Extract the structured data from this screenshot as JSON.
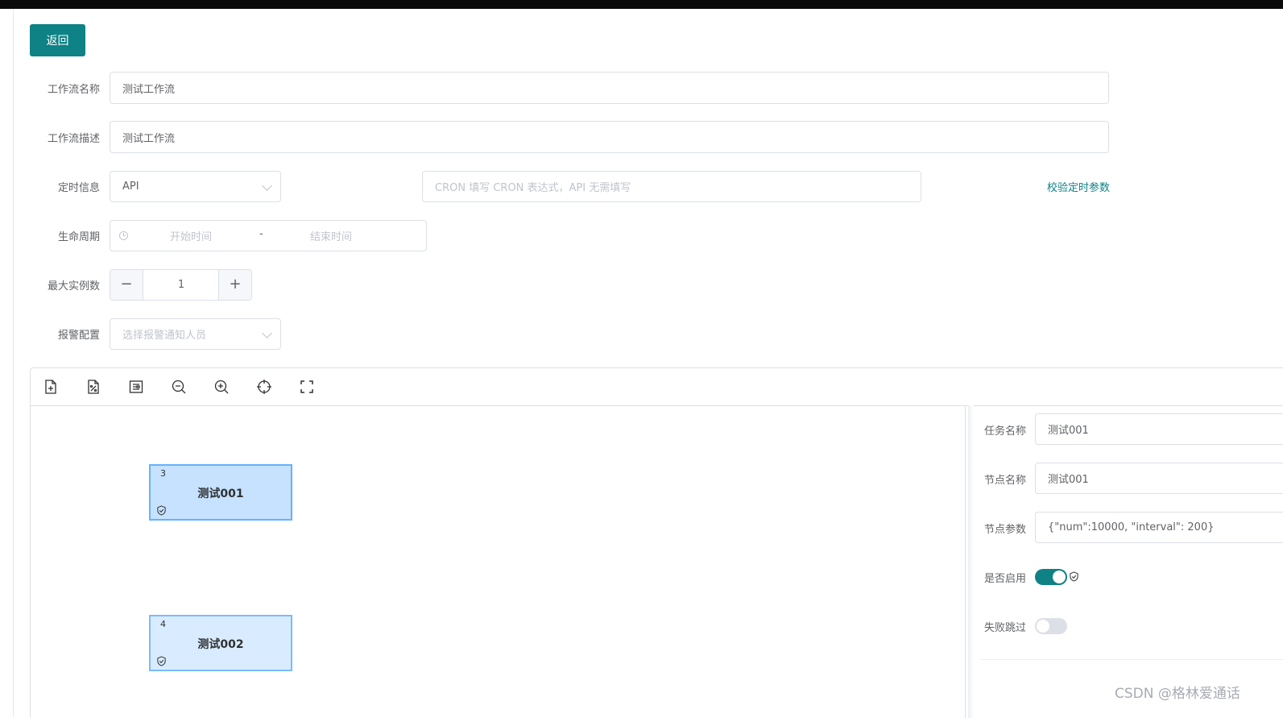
{
  "header": {
    "back_label": "返回"
  },
  "form": {
    "name_label": "工作流名称",
    "name_value": "测试工作流",
    "desc_label": "工作流描述",
    "desc_value": "测试工作流",
    "schedule_label": "定时信息",
    "schedule_type": "API",
    "cron_placeholder": "CRON 填写 CRON 表达式，API 无需填写",
    "validate_link": "校验定时参数",
    "lifecycle_label": "生命周期",
    "start_placeholder": "开始时间",
    "range_separator": "-",
    "end_placeholder": "结束时间",
    "max_instances_label": "最大实例数",
    "max_instances_value": "1",
    "minus_symbol": "−",
    "plus_symbol": "+",
    "alarm_label": "报警配置",
    "alarm_placeholder": "选择报警通知人员"
  },
  "toolbar": {
    "tools": [
      "add-file-icon",
      "percent-file-icon",
      "layout-icon",
      "zoom-out-icon",
      "zoom-in-icon",
      "locate-icon",
      "fullscreen-icon"
    ]
  },
  "canvas": {
    "nodes": [
      {
        "id": "3",
        "title": "测试001",
        "selected": true
      },
      {
        "id": "4",
        "title": "测试002",
        "selected": false
      }
    ]
  },
  "panel": {
    "task_name_label": "任务名称",
    "task_name_value": "测试001",
    "node_name_label": "节点名称",
    "node_name_value": "测试001",
    "node_params_label": "节点参数",
    "node_params_value": "{\"num\":10000, \"interval\": 200}",
    "enabled_label": "是否启用",
    "enabled": true,
    "skip_on_fail_label": "失败跳过",
    "skip_on_fail": false
  },
  "watermark": "CSDN @格林爱通话",
  "colors": {
    "primary": "#0e8285",
    "node_fill": "#c6e2ff",
    "node_border": "#66b1ff"
  }
}
